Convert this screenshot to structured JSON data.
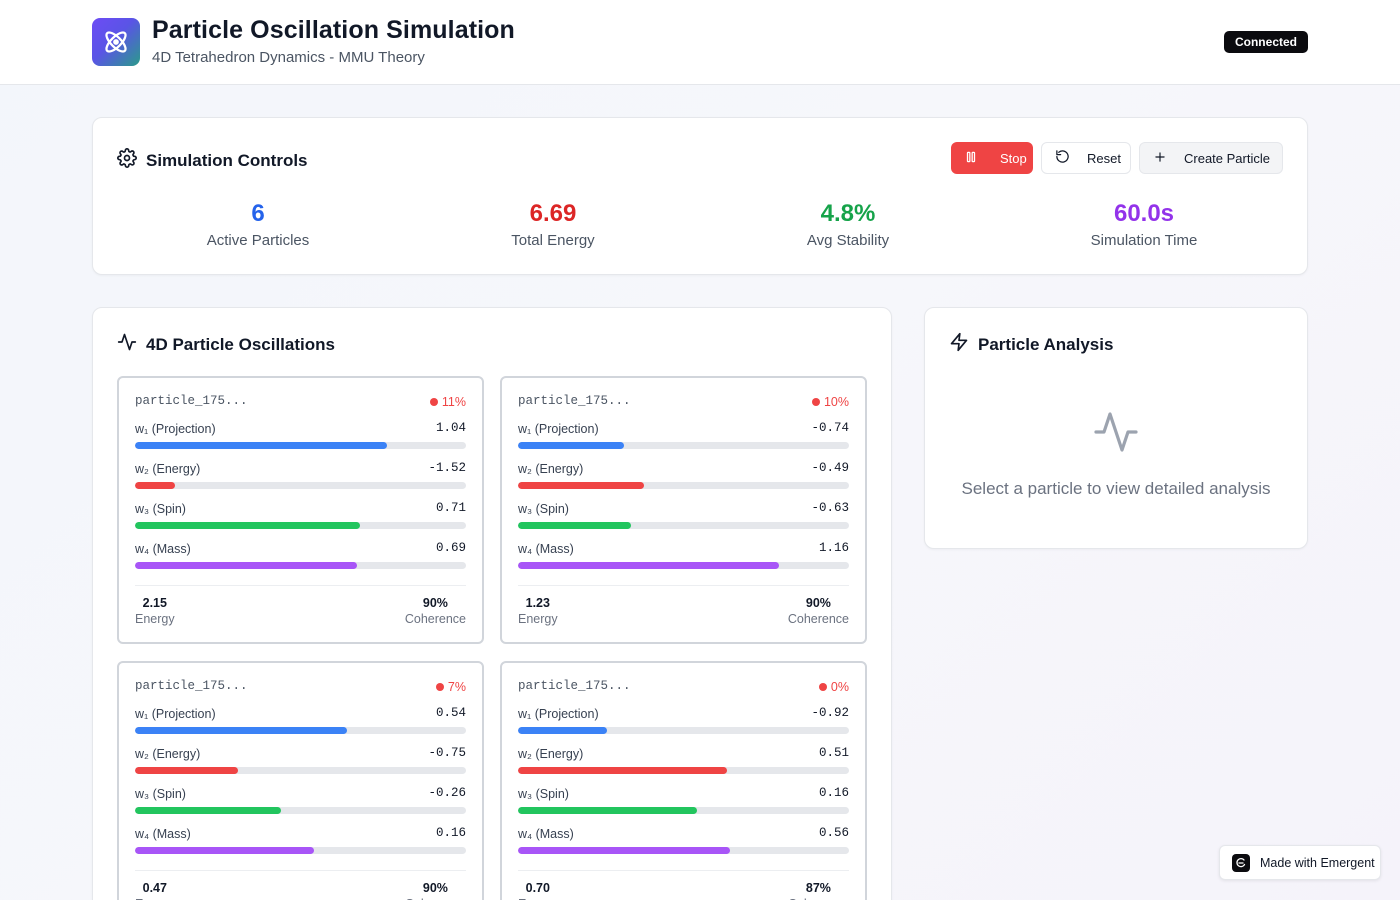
{
  "header": {
    "title": "Particle Oscillation Simulation",
    "subtitle": "4D Tetrahedron Dynamics - MMU Theory",
    "logo_icon": "atom-icon",
    "status_badge": "Connected"
  },
  "controls": {
    "title": "Simulation Controls",
    "icon": "gear-icon",
    "buttons": {
      "stop": "Stop",
      "reset": "Reset",
      "create": "Create Particle"
    },
    "stats": [
      {
        "value": "6",
        "label": "Active Particles",
        "color": "#2563eb"
      },
      {
        "value": "6.69",
        "label": "Total Energy",
        "color": "#dc2626"
      },
      {
        "value": "4.8%",
        "label": "Avg Stability",
        "color": "#16a34a"
      },
      {
        "value": "60.0s",
        "label": "Simulation Time",
        "color": "#9333ea"
      }
    ]
  },
  "oscillations": {
    "title": "4D Particle Oscillations",
    "icon": "activity-icon",
    "dim_labels": [
      "w₁ (Projection)",
      "w₂ (Energy)",
      "w₃ (Spin)",
      "w₄ (Mass)"
    ],
    "dim_colors": [
      "#3b82f6",
      "#ef4444",
      "#22c55e",
      "#a855f7"
    ],
    "energy_label": "Energy",
    "coherence_label": "Coherence",
    "particles": [
      {
        "id": "particle_175...",
        "stability": "11%",
        "values": [
          "1.04",
          "-1.52",
          "0.71",
          "0.69"
        ],
        "fill_fractions": [
          0.76,
          0.12,
          0.68,
          0.67
        ],
        "energy": "2.15",
        "coherence": "90%"
      },
      {
        "id": "particle_175...",
        "stability": "10%",
        "values": [
          "-0.74",
          "-0.49",
          "-0.63",
          "1.16"
        ],
        "fill_fractions": [
          0.32,
          0.38,
          0.34,
          0.79
        ],
        "energy": "1.23",
        "coherence": "90%"
      },
      {
        "id": "particle_175...",
        "stability": "7%",
        "values": [
          "0.54",
          "-0.75",
          "-0.26",
          "0.16"
        ],
        "fill_fractions": [
          0.64,
          0.31,
          0.44,
          0.54
        ],
        "energy": "0.47",
        "coherence": "90%"
      },
      {
        "id": "particle_175...",
        "stability": "0%",
        "values": [
          "-0.92",
          "0.51",
          "0.16",
          "0.56"
        ],
        "fill_fractions": [
          0.27,
          0.63,
          0.54,
          0.64
        ],
        "energy": "0.70",
        "coherence": "87%"
      }
    ]
  },
  "analysis": {
    "title": "Particle Analysis",
    "icon": "zap-icon",
    "empty_icon": "activity-icon",
    "empty_text": "Select a particle to view detailed analysis"
  },
  "badge": {
    "text": "Made with Emergent"
  }
}
